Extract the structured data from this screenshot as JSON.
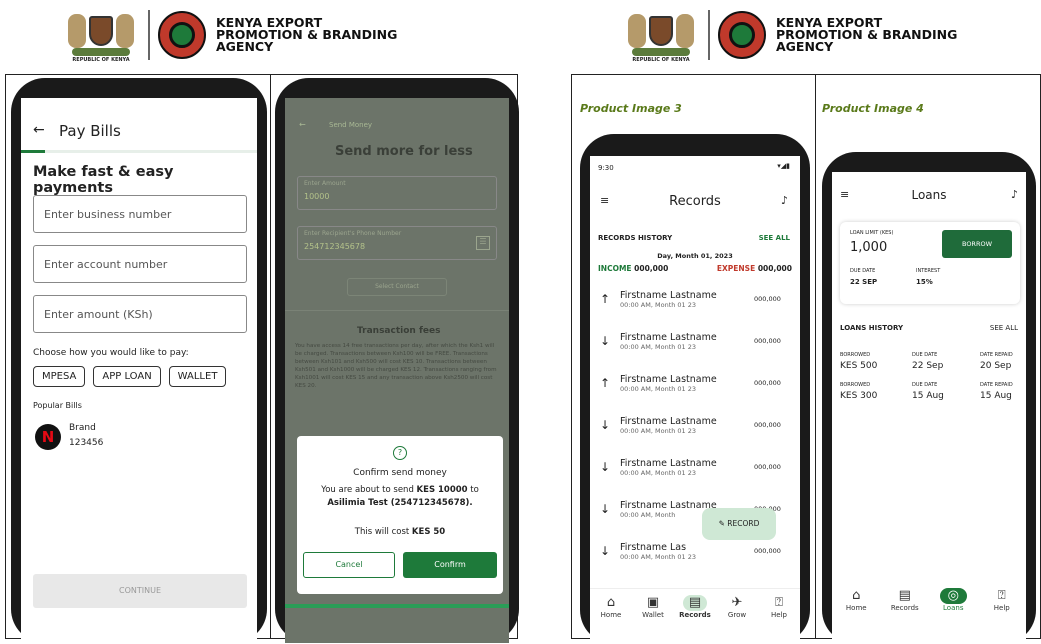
{
  "header": {
    "agency_line1": "KENYA EXPORT",
    "agency_line2": "PROMOTION & BRANDING",
    "agency_line3": "AGENCY",
    "republic": "REPUBLIC OF KENYA"
  },
  "left": {
    "paybills": {
      "back_icon": "back-arrow-icon",
      "title": "Pay Bills",
      "heading": "Make fast & easy payments",
      "business_placeholder": "Enter business number",
      "account_placeholder": "Enter account number",
      "amount_placeholder": "Enter amount (KSh)",
      "choose_label": "Choose how you would like to pay:",
      "options": [
        "MPESA",
        "APP LOAN",
        "WALLET"
      ],
      "popular_label": "Popular Bills",
      "brand_name": "Brand",
      "brand_number": "123456",
      "continue_label": "CONTINUE"
    },
    "send": {
      "back_label": "Send Money",
      "title": "Send more for less",
      "amount_label": "Enter Amount",
      "amount_value": "10000",
      "recipient_label": "Enter Recipient's Phone Number",
      "recipient_value": "254712345678",
      "contact_label": "Select Contact",
      "fees_title": "Transaction fees",
      "fees_text": "You have access 14 free transactions per day, after which the Ksh1 will be charged. Transactions between Ksh100 will be FREE. Transactions between Ksh101 and Ksh500 will cost KES 10. Transactions between Ksh501 and Ksh1000 will be charged KES 12. Transactions ranging from Ksh1001 will cost KES 15 and any transaction above Ksh2500 will cost KES 20.",
      "dialog_icon": "question-icon",
      "dialog_title": "Confirm send money",
      "dialog_text_1": "You are about to send ",
      "dialog_amount": "KES 10000",
      "dialog_text_2": " to ",
      "dialog_recipient": "Asilimia Test (254712345678).",
      "dialog_cost_prefix": "This will cost ",
      "dialog_cost": "KES 50",
      "cancel_label": "Cancel",
      "confirm_label": "Confirm"
    }
  },
  "right": {
    "product3_label": "Product Image 3",
    "product4_label": "Product Image 4",
    "records": {
      "time": "9:30",
      "title": "Records",
      "history_label": "RECORDS HISTORY",
      "see_all": "SEE ALL",
      "date_label": "Day, Month 01, 2023",
      "income_label": "INCOME",
      "income_value": "000,000",
      "expense_label": "EXPENSE",
      "expense_value": "000,000",
      "rows": [
        {
          "dir": "up",
          "name": "Firstname Lastname",
          "time": "00:00 AM, Month 01 23",
          "amount": "000,000"
        },
        {
          "dir": "down",
          "name": "Firstname Lastname",
          "time": "00:00 AM, Month 01 23",
          "amount": "000,000"
        },
        {
          "dir": "up",
          "name": "Firstname Lastname",
          "time": "00:00 AM, Month 01 23",
          "amount": "000,000"
        },
        {
          "dir": "down",
          "name": "Firstname Lastname",
          "time": "00:00 AM, Month 01 23",
          "amount": "000,000"
        },
        {
          "dir": "down",
          "name": "Firstname Lastname",
          "time": "00:00 AM, Month 01 23",
          "amount": "000,000"
        },
        {
          "dir": "down",
          "name": "Firstname Lastname",
          "time": "00:00 AM, Month",
          "amount": "000,000"
        },
        {
          "dir": "down",
          "name": "Firstname Las",
          "time": "00:00 AM, Month 01 23",
          "amount": "000,000"
        }
      ],
      "record_button": "RECORD",
      "nav": [
        "Home",
        "Wallet",
        "Records",
        "Grow",
        "Help"
      ]
    },
    "loans": {
      "title": "Loans",
      "limit_label": "LOAN LIMIT (KES)",
      "limit_value": "1,000",
      "borrow_label": "BORROW",
      "due_label": "DUE DATE",
      "due_value": "22 SEP",
      "interest_label": "INTEREST",
      "interest_value": "15%",
      "history_label": "LOANS HISTORY",
      "see_all": "SEE ALL",
      "rows": [
        {
          "borrowed_label": "BORROWED",
          "borrowed": "KES 500",
          "due_label": "DUE DATE",
          "due": "22 Sep",
          "repaid_label": "DATE REPAID",
          "repaid": "20 Sep"
        },
        {
          "borrowed_label": "BORROWED",
          "borrowed": "KES 300",
          "due_label": "DUE DATE",
          "due": "15 Aug",
          "repaid_label": "DATE REPAID",
          "repaid": "15 Aug"
        }
      ],
      "nav": [
        "Home",
        "Records",
        "Loans",
        "Help"
      ]
    }
  },
  "colors": {
    "accent_green": "#1e7a3a",
    "dark_green": "#1f6b3a",
    "label_olive": "#5a7a1a",
    "expense_red": "#c0392b",
    "light_green": "#cfe8d5"
  }
}
